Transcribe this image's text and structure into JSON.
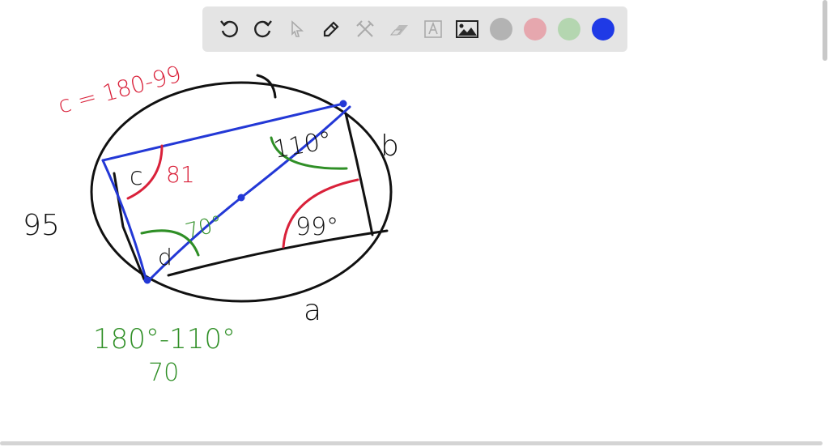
{
  "toolbar": {
    "tools": [
      "undo-icon",
      "redo-icon",
      "select-icon",
      "pen-icon",
      "tools-icon",
      "eraser-icon",
      "text-icon",
      "image-icon"
    ],
    "colors": [
      "#b3b3b3",
      "#e6a7ae",
      "#b4d6b0",
      "#1f3ae6"
    ]
  },
  "drawing": {
    "colors": {
      "black": "#111111",
      "red": "#d9213a",
      "green": "#2f8f26",
      "blue": "#2338d6"
    },
    "labels": {
      "c_formula": "c = 180-99",
      "side_95": "95",
      "side_b": "b",
      "side_a": "a",
      "angle_c": "c",
      "angle_81": "81",
      "angle_110": "110°",
      "angle_99": "99°",
      "angle_70_inner": "70°",
      "angle_d": "d",
      "d_formula": "180°-110°",
      "d_result": "70"
    }
  }
}
